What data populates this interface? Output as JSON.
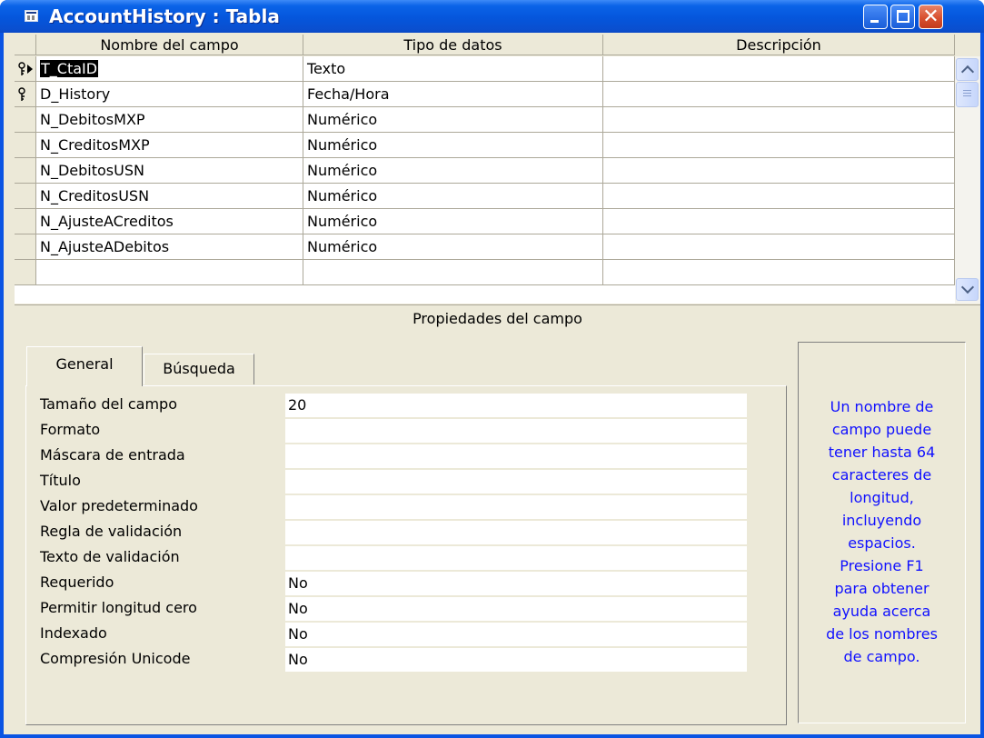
{
  "window": {
    "title": "AccountHistory : Tabla",
    "close_glyph": "✕"
  },
  "grid": {
    "columns": [
      "Nombre del campo",
      "Tipo de datos",
      "Descripción"
    ],
    "rows": [
      {
        "name": "T_CtaID",
        "type": "Texto",
        "description": "",
        "primary_key": true,
        "current": true
      },
      {
        "name": "D_History",
        "type": "Fecha/Hora",
        "description": "",
        "primary_key": true,
        "current": false
      },
      {
        "name": "N_DebitosMXP",
        "type": "Numérico",
        "description": ""
      },
      {
        "name": "N_CreditosMXP",
        "type": "Numérico",
        "description": ""
      },
      {
        "name": "N_DebitosUSN",
        "type": "Numérico",
        "description": ""
      },
      {
        "name": "N_CreditosUSN",
        "type": "Numérico",
        "description": ""
      },
      {
        "name": "N_AjusteACreditos",
        "type": "Numérico",
        "description": ""
      },
      {
        "name": "N_AjusteADebitos",
        "type": "Numérico",
        "description": ""
      }
    ]
  },
  "properties": {
    "section_title": "Propiedades del campo",
    "tabs": [
      "General",
      "Búsqueda"
    ],
    "active_tab": "General",
    "rows": [
      {
        "label": "Tamaño del campo",
        "value": "20"
      },
      {
        "label": "Formato",
        "value": ""
      },
      {
        "label": "Máscara de entrada",
        "value": ""
      },
      {
        "label": "Título",
        "value": ""
      },
      {
        "label": "Valor predeterminado",
        "value": ""
      },
      {
        "label": "Regla de validación",
        "value": ""
      },
      {
        "label": "Texto de validación",
        "value": ""
      },
      {
        "label": "Requerido",
        "value": "No"
      },
      {
        "label": "Permitir longitud cero",
        "value": "No"
      },
      {
        "label": "Indexado",
        "value": "No"
      },
      {
        "label": "Compresión Unicode",
        "value": "No"
      }
    ]
  },
  "help": {
    "lines": [
      "Un nombre de",
      "campo puede",
      "tener hasta 64",
      "caracteres de",
      "longitud,",
      "incluyendo",
      "espacios.",
      "Presione F1",
      "para obtener",
      "ayuda acerca",
      "de los nombres",
      "de campo."
    ],
    "color": "#1010ff"
  },
  "colors": {
    "titlebar": "#0556dc",
    "face": "#ece9d8"
  }
}
